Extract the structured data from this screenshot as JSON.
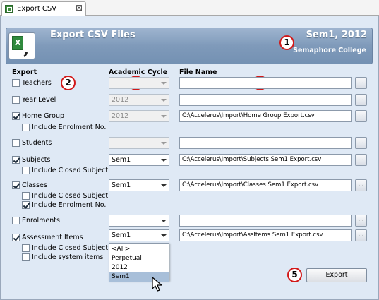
{
  "tab": {
    "label": "Export CSV",
    "close_glyph": "⊠"
  },
  "header": {
    "title": "Export CSV Files",
    "term": "Sem1, 2012",
    "school": "Semaphore College",
    "icon": "excel-csv-icon"
  },
  "markers": [
    "1",
    "2",
    "3",
    "4",
    "5"
  ],
  "columns": {
    "export": "Export",
    "cycle": "Academic Cycle",
    "file": "File Name"
  },
  "rows": {
    "teachers": {
      "label": "Teachers",
      "checked": false,
      "cycle": "",
      "path": ""
    },
    "year_level": {
      "label": "Year Level",
      "checked": false,
      "cycle": "2012",
      "path": ""
    },
    "home_group": {
      "label": "Home Group",
      "checked": true,
      "cycle": "2012",
      "path": "C:\\Accelerus\\Import\\Home Group Export.csv"
    },
    "home_group_enrol": {
      "label": "Include Enrolment No.",
      "checked": false
    },
    "students": {
      "label": "Students",
      "checked": false,
      "cycle": "",
      "path": ""
    },
    "subjects": {
      "label": "Subjects",
      "checked": true,
      "cycle": "Sem1",
      "path": "C:\\Accelerus\\Import\\Subjects Sem1 Export.csv"
    },
    "subjects_closed": {
      "label": "Include Closed Subject",
      "checked": false
    },
    "classes": {
      "label": "Classes",
      "checked": true,
      "cycle": "Sem1",
      "path": "C:\\Accelerus\\Import\\Classes Sem1 Export.csv"
    },
    "classes_closed": {
      "label": "Include Closed Subject",
      "checked": false
    },
    "classes_enrol": {
      "label": "Include Enrolment No.",
      "checked": true
    },
    "enrolments": {
      "label": "Enrolments",
      "checked": false,
      "cycle": "",
      "path": ""
    },
    "assessment": {
      "label": "Assessment Items",
      "checked": true,
      "cycle": "Sem1",
      "path": "C:\\Accelerus\\Import\\AssItems Sem1 Export.csv"
    },
    "assessment_closed": {
      "label": "Include Closed Subject",
      "checked": false
    },
    "assessment_system": {
      "label": "Include system items",
      "checked": false
    }
  },
  "browse_label": "...",
  "dropdown": {
    "options": [
      "<All>",
      "Perpetual",
      "2012",
      "Sem1"
    ],
    "selected": "Sem1"
  },
  "export_button": "Export"
}
